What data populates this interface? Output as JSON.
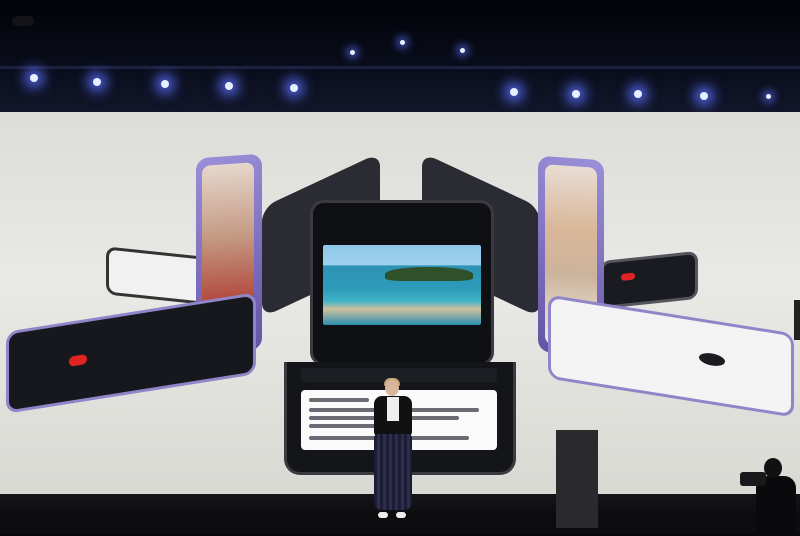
{
  "scene": {
    "description_type": "photo",
    "colors": {
      "phone_purple": "#8e7fd2",
      "stage_light": "#5a6eff",
      "screen_backdrop": "#e4e4e0"
    }
  }
}
